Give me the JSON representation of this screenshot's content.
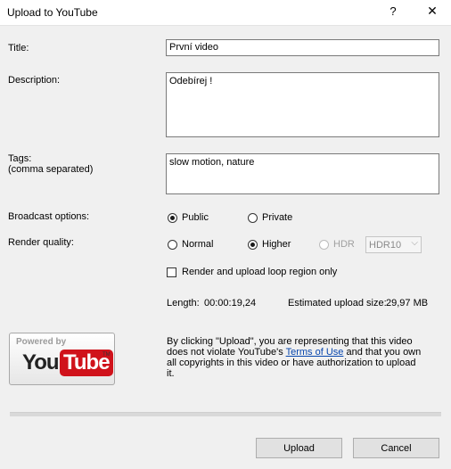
{
  "window": {
    "title": "Upload to YouTube",
    "help_label": "?",
    "close_label": "✕"
  },
  "form": {
    "title_label": "Title:",
    "title_value": "První video",
    "description_label": "Description:",
    "description_value": "Odebírej !",
    "tags_label": "Tags:",
    "tags_sublabel": "(comma separated)",
    "tags_value": "slow motion, nature",
    "broadcast_label": "Broadcast options:",
    "broadcast_options": [
      "Public",
      "Private"
    ],
    "broadcast_selected": "Public",
    "quality_label": "Render quality:",
    "quality_options": [
      "Normal",
      "Higher",
      "HDR"
    ],
    "quality_selected": "Higher",
    "hdr_select_value": "HDR10",
    "loop_region_label": "Render and upload loop region only",
    "loop_region_checked": false
  },
  "info": {
    "length_label": "Length:",
    "length_value": "00:00:19,24",
    "size_label": "Estimated upload size:",
    "size_value": "29,97 MB"
  },
  "logo": {
    "powered_by": "Powered by",
    "you": "You",
    "tube": "Tube",
    "tm": "TM"
  },
  "legal": {
    "text_before": "By clicking \"Upload\", you are representing that this video does not violate YouTube's ",
    "link_text": "Terms of Use",
    "text_after": " and that you own all copyrights in this video or have authorization to upload it."
  },
  "buttons": {
    "upload": "Upload",
    "cancel": "Cancel"
  }
}
